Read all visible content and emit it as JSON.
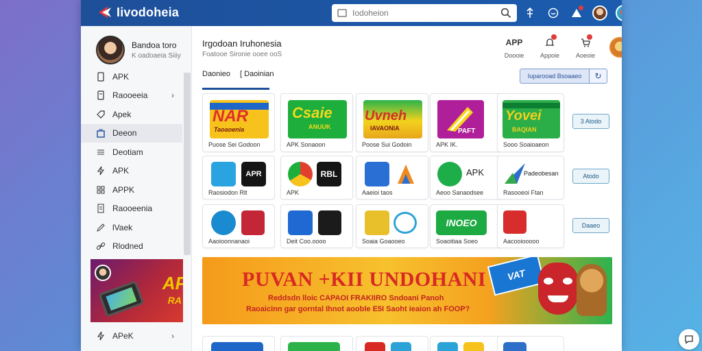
{
  "app": {
    "logo_text": "Iivodoheia"
  },
  "search": {
    "placeholder": "Iodoheion"
  },
  "sidebar": {
    "profile": {
      "name": "Bandoa toro",
      "sub": "K oadoaeia Siiiy"
    },
    "items": [
      {
        "label": "APK",
        "icon": "file-icon"
      },
      {
        "label": "Raooeeia",
        "icon": "file-icon",
        "chevron": true
      },
      {
        "label": "Apek",
        "icon": "tag-icon"
      },
      {
        "label": "Deeon",
        "icon": "bag-icon",
        "active": true
      },
      {
        "label": "Deotiam",
        "icon": "list-icon"
      },
      {
        "label": "APK",
        "icon": "bolt-icon"
      },
      {
        "label": "APPK",
        "icon": "grid-icon"
      },
      {
        "label": "Raooeenia",
        "icon": "doc-icon"
      },
      {
        "label": "lVaek",
        "icon": "pen-icon"
      },
      {
        "label": "Rlodned",
        "icon": "link-icon"
      }
    ],
    "ad": {
      "text": "AP",
      "text2": "RA"
    },
    "bottom_items": [
      {
        "label": "APeK",
        "chevron": true
      }
    ]
  },
  "main": {
    "title": "Irgodoan Iruhonesia",
    "subtitle": "Foatooe Sironie ooee ooS",
    "actions": [
      {
        "label": "Doooie",
        "icon": "apk-icon",
        "icon_text": "APP"
      },
      {
        "label": "Appoie",
        "icon": "bell-icon"
      },
      {
        "label": "Aoeoie",
        "icon": "cart-icon"
      }
    ],
    "tabs": [
      {
        "label": "Daonieo",
        "active": true
      },
      {
        "label": "[ Daoinian"
      }
    ],
    "filter": {
      "label": "Iuparooad Bsoaaeo"
    }
  },
  "apps": [
    {
      "caption": "Puose Sei Godoon",
      "art_text": "NAR",
      "art_sub": "Taoaoenia",
      "colors": [
        "#f6c21b",
        "#e02f2a",
        "#1f66c9"
      ]
    },
    {
      "caption": "APK Sonaoon",
      "art_text": "Csaie",
      "art_sub": "ANUUK",
      "colors": [
        "#1eae3b",
        "#f3d91d",
        "#0a7a2a"
      ]
    },
    {
      "caption": "Poose Sui Godoin",
      "art_text": "Uvneh",
      "art_sub": "IAVAONIA",
      "colors": [
        "#2bb34a",
        "#f3d21d",
        "#d23227"
      ]
    },
    {
      "caption": "APK IK.",
      "art_text": "PAFT",
      "art_sub": "",
      "colors": [
        "#b01f9a",
        "#f6d91a",
        "#7d1a8a"
      ]
    },
    {
      "caption": "Sooo Soaioaeon",
      "art_text": "Yovei",
      "art_sub": "BAQIAN",
      "colors": [
        "#2bae47",
        "#f4cf1f",
        "#0d7f32"
      ]
    },
    {
      "caption": "Raosiodon Rlt",
      "art_text": "APR",
      "art_sub": "",
      "colors": [
        "#29a4e0",
        "#151515"
      ]
    },
    {
      "caption": "APK",
      "art_text": "RBL",
      "art_sub": "",
      "colors": [
        "#e2402f",
        "#151515"
      ]
    },
    {
      "caption": "Aaeioi taos",
      "art_text": "",
      "art_sub": "",
      "colors": [
        "#2a6fd3",
        "#f08a1f"
      ]
    },
    {
      "caption": "Aeoo Sanaodsee",
      "art_text": "APK",
      "art_sub": "",
      "colors": [
        "#1dae4a",
        "#ffffff"
      ]
    },
    {
      "caption": "Rasooeoi Ftan",
      "art_text": "Padeobesan",
      "art_sub": "",
      "colors": [
        "#2d6ec8",
        "#36a94d"
      ]
    },
    {
      "caption": "Aaoioonnanaoi",
      "art_text": "",
      "art_sub": "",
      "colors": [
        "#1a8bd0",
        "#c32636"
      ]
    },
    {
      "caption": "Deit Coo.oooo",
      "art_text": "",
      "art_sub": "",
      "colors": [
        "#1f6ad2",
        "#1b1b1b"
      ]
    },
    {
      "caption": "Soaia Goaooeo",
      "art_text": "",
      "art_sub": "",
      "colors": [
        "#e8c02b",
        "#2ca3d6"
      ]
    },
    {
      "caption": "Soaoitiaa Soeo",
      "art_text": "INOEO",
      "art_sub": "",
      "colors": [
        "#1eaa43",
        "#f5c72a"
      ]
    },
    {
      "caption": "Aacooiooooo",
      "art_text": "",
      "art_sub": "",
      "colors": [
        "#d72d2d",
        "#ffffff"
      ]
    }
  ],
  "row_buttons": [
    "3 Atodo",
    "Atodo",
    "Daaeo"
  ],
  "banner": {
    "title": "PUVAN +KII UNDOHANI",
    "line1": "Reddsdn lloic CAPAOI FRAKIIRO Sndoani Panoh",
    "line2": "Raoaicinn gar gorntal Ihnot aooble E5I Saoht ieaion ah FOOP?",
    "tag": "VAT"
  }
}
